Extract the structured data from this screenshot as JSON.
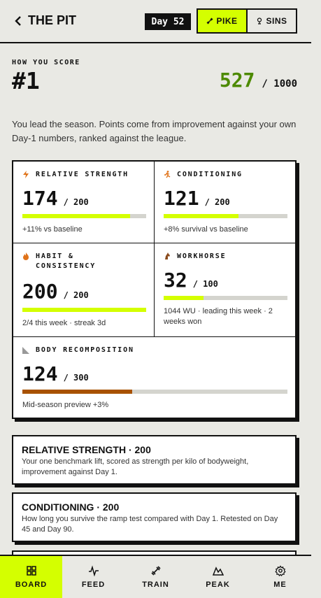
{
  "header": {
    "title": "THE PIT",
    "day_badge": "Day 52",
    "toggle": [
      {
        "label": "PIKE",
        "icon": "dumbbell-icon",
        "active": true
      },
      {
        "label": "SINS",
        "icon": "pin-icon",
        "active": false
      }
    ]
  },
  "score": {
    "label": "HOW YOU SCORE",
    "rank": "#1",
    "points": "527",
    "points_max": "/ 1000",
    "summary": "You lead the season. Points come from improvement against your own Day-1 numbers, ranked against the league."
  },
  "categories": [
    {
      "title": "RELATIVE STRENGTH",
      "icon": "bolt-icon",
      "score": "174",
      "max": "/ 200",
      "fraction": 0.87,
      "bar_color": "#d4ff00",
      "note": "+11% vs baseline"
    },
    {
      "title": "CONDITIONING",
      "icon": "runner-icon",
      "score": "121",
      "max": "/ 200",
      "fraction": 0.605,
      "bar_color": "#d4ff00",
      "note": "+8% survival vs baseline"
    },
    {
      "title": "HABIT & CONSISTENCY",
      "icon": "flame-icon",
      "score": "200",
      "max": "/ 200",
      "fraction": 1.0,
      "bar_color": "#d4ff00",
      "note": "2/4 this week · streak 3d"
    },
    {
      "title": "WORKHORSE",
      "icon": "horse-icon",
      "score": "32",
      "max": "/ 100",
      "fraction": 0.32,
      "bar_color": "#d4ff00",
      "note": "1044 WU · leading this week · 2 weeks won"
    },
    {
      "title": "BODY RECOMPOSITION",
      "icon": "ruler-icon",
      "score": "124",
      "max": "/ 300",
      "fraction": 0.413,
      "bar_color": "#a85200",
      "note": "Mid-season preview +3%"
    }
  ],
  "info_cards": [
    {
      "title": "RELATIVE STRENGTH · 200",
      "text": "Your one benchmark lift, scored as strength per kilo of bodyweight, improvement against Day 1."
    },
    {
      "title": "CONDITIONING · 200",
      "text": "How long you survive the ramp test compared with Day 1. Retested on Day 45 and Day 90."
    }
  ],
  "nav": [
    {
      "label": "BOARD",
      "icon": "grid-icon",
      "active": true
    },
    {
      "label": "FEED",
      "icon": "pulse-icon",
      "active": false
    },
    {
      "label": "TRAIN",
      "icon": "dumbbell-icon",
      "active": false
    },
    {
      "label": "PEAK",
      "icon": "mountain-icon",
      "active": false
    },
    {
      "label": "ME",
      "icon": "gear-icon",
      "active": false
    }
  ],
  "colors": {
    "accent": "#d4ff00",
    "points": "#4d8a00",
    "recomp": "#a85200"
  }
}
